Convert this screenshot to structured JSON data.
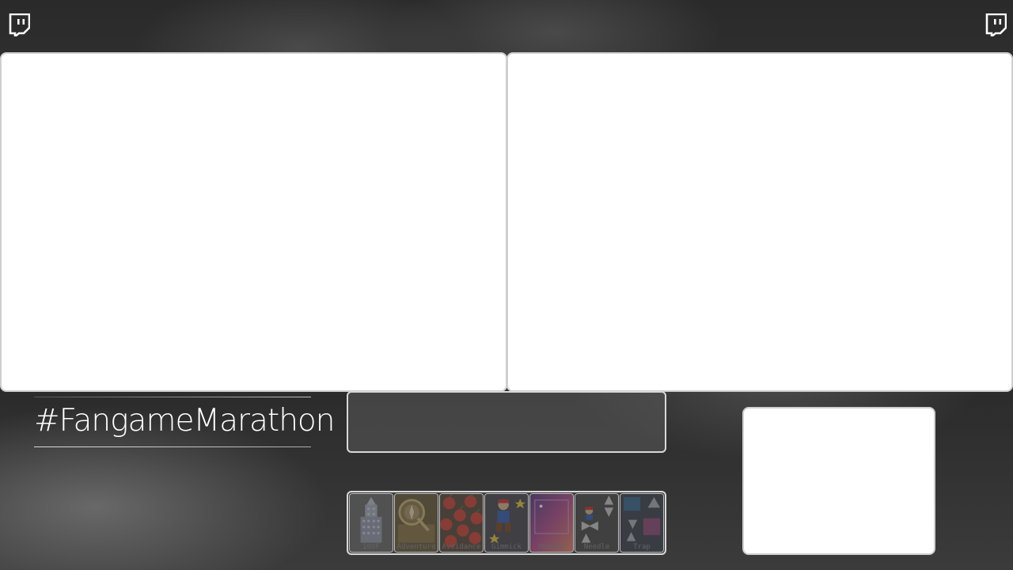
{
  "hashtag": "#FangameMarathon",
  "icons": {
    "corner": "twitch-icon"
  },
  "categories": [
    {
      "label": "100F",
      "icon": "tower-icon"
    },
    {
      "label": "Adventure",
      "icon": "compass-icon"
    },
    {
      "label": "Avoidance",
      "icon": "cherries-icon"
    },
    {
      "label": "Gimmick",
      "icon": "character-icon"
    },
    {
      "label": "Medley",
      "icon": "medley-icon"
    },
    {
      "label": "Needle",
      "icon": "spikes-icon"
    },
    {
      "label": "Trap",
      "icon": "trap-icon"
    }
  ]
}
